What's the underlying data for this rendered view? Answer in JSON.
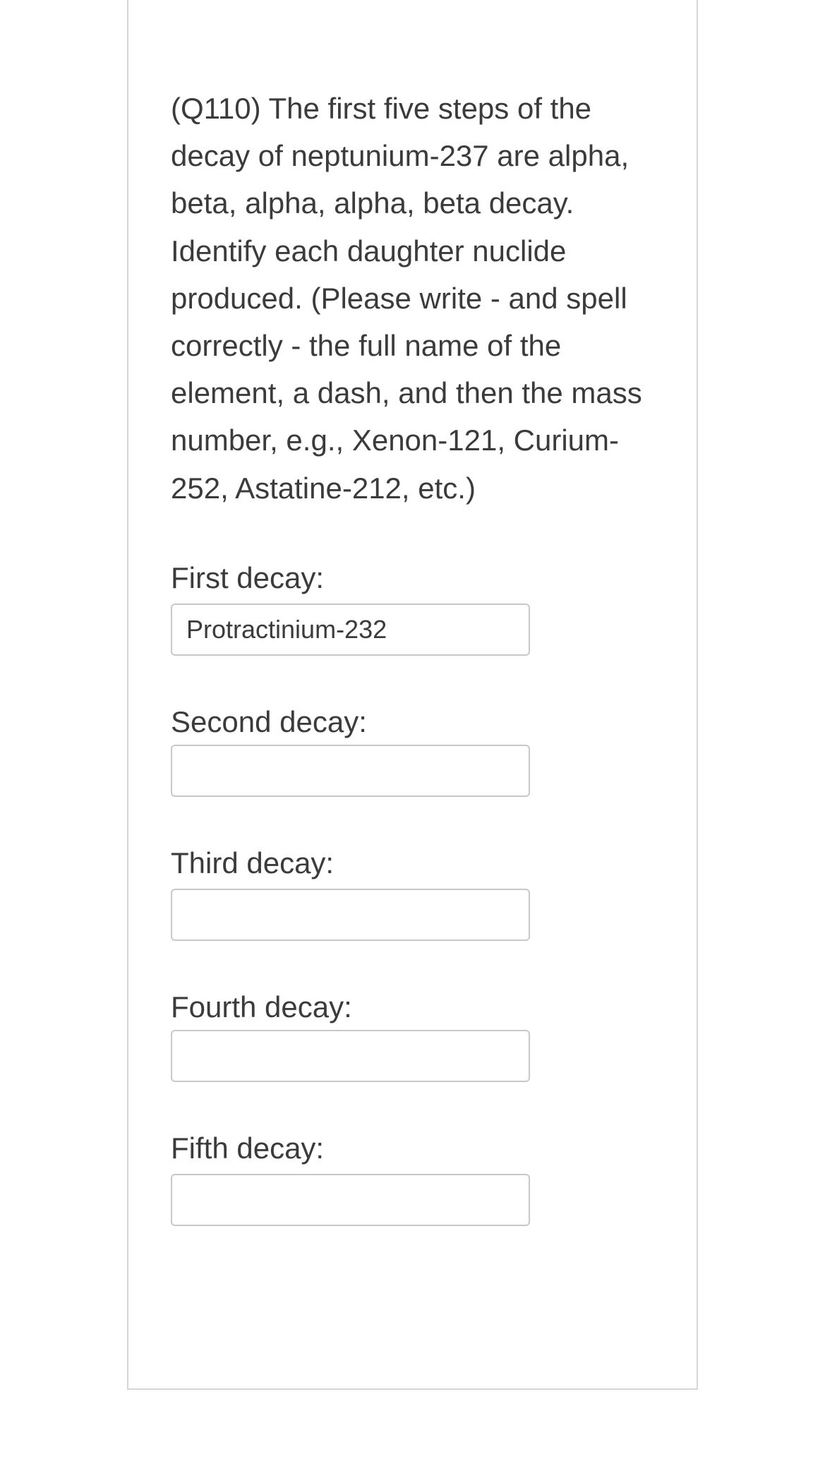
{
  "question": {
    "text": "(Q110) The first five steps of the decay of neptunium-237 are alpha, beta, alpha, alpha, beta decay.  Identify each daughter nuclide produced.  (Please write - and spell correctly - the full name of the element, a dash, and then the mass number,  e.g., Xenon-121, Curium-252, Astatine-212, etc.)"
  },
  "fields": {
    "first": {
      "label": "First decay:",
      "value": "Protractinium-232"
    },
    "second": {
      "label": "Second decay:",
      "value": ""
    },
    "third": {
      "label": "Third decay:",
      "value": ""
    },
    "fourth": {
      "label": "Fourth decay:",
      "value": ""
    },
    "fifth": {
      "label": "Fifth decay:",
      "value": ""
    }
  }
}
